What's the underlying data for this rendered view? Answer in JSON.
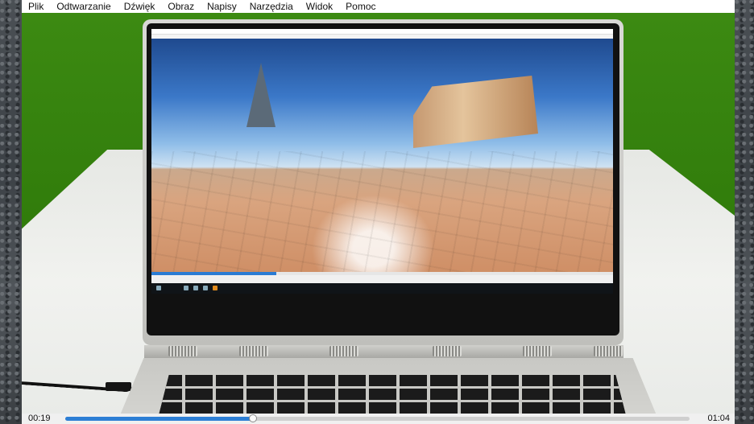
{
  "menu": {
    "items": [
      "Plik",
      "Odtwarzanie",
      "Dźwięk",
      "Obraz",
      "Napisy",
      "Narzędzia",
      "Widok",
      "Pomoc"
    ]
  },
  "player": {
    "elapsed": "00:19",
    "total": "01:04",
    "progress": 0.3
  },
  "inner_screen": {
    "seek_progress": 0.27
  }
}
